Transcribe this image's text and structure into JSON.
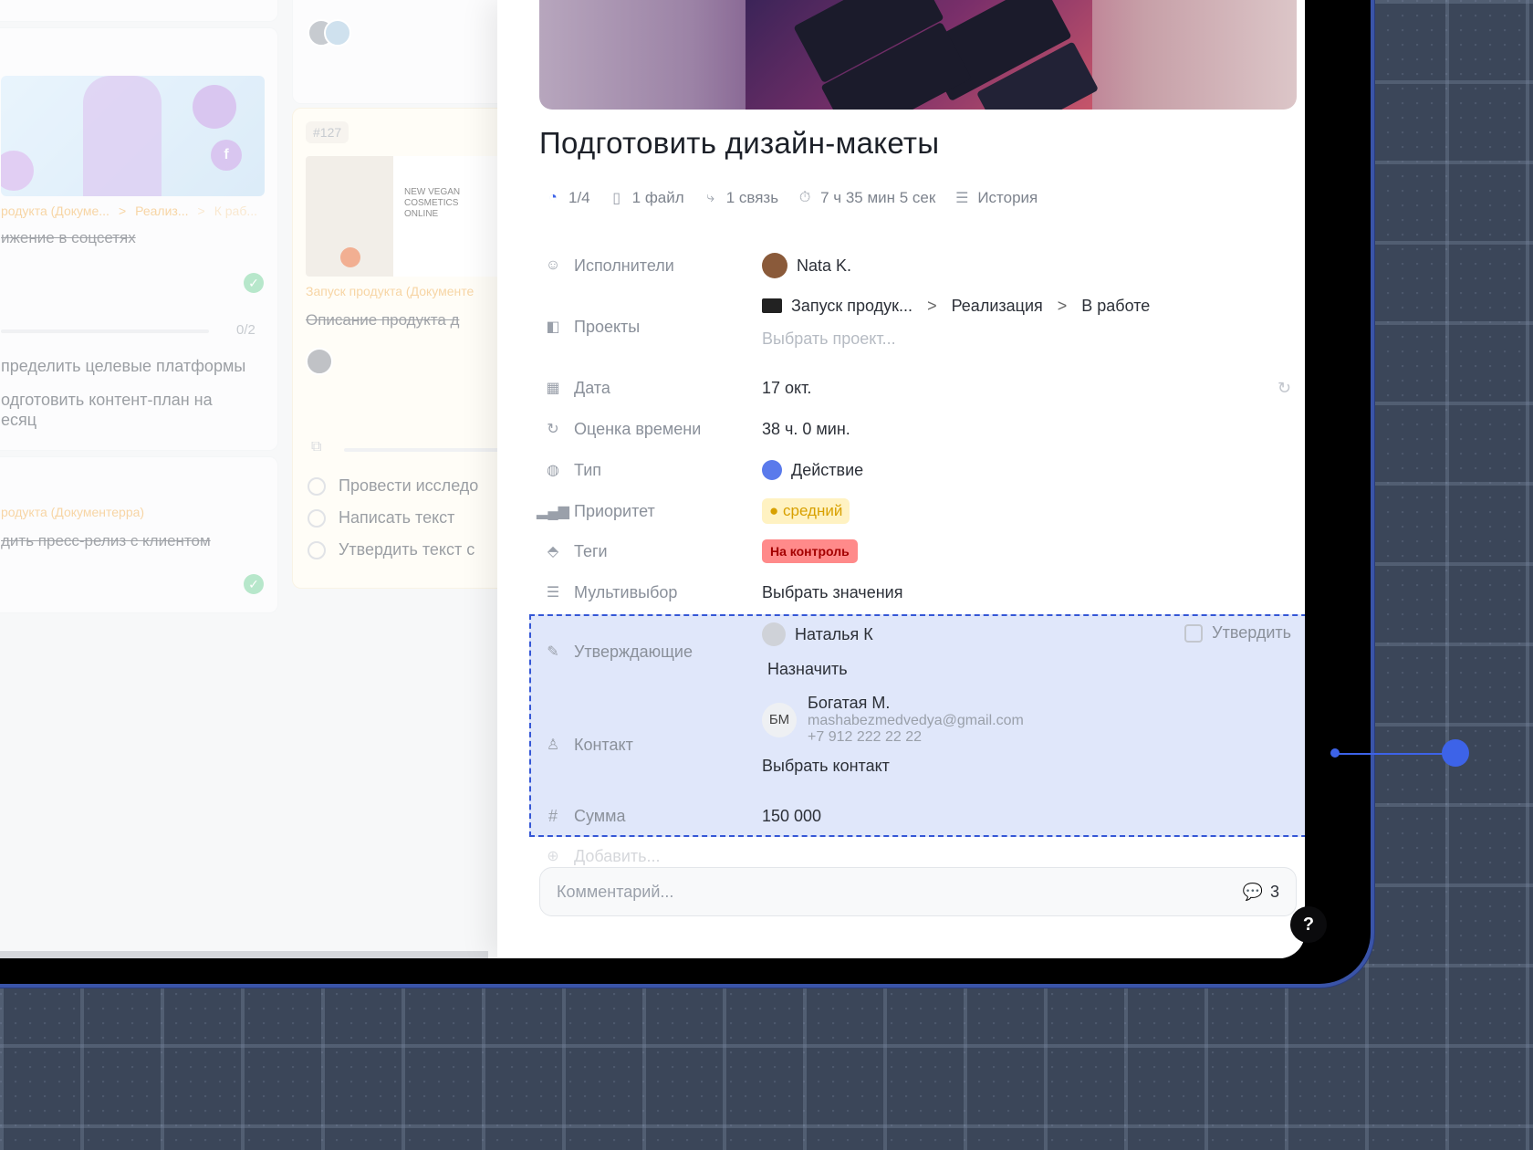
{
  "board": {
    "card1_bullet_text": "ижение в соцсетях",
    "card1_breadcrumb": "родукта (Докуме...",
    "card1_breadcrumb2": "Реализ...",
    "card1_breadcrumb3": "К раб...",
    "card1_progress": "0/2",
    "card1_items": [
      "пределить целевые платформы",
      "одготовить контент-план на",
      "есяц"
    ],
    "card2_breadcrumb": "родукта (Документерра)",
    "card2_strike": "дить пресс-релиз с клиентом",
    "card3_id": "#127",
    "card3_breadcrumb": "Запуск продукта (Документе",
    "card3_strike": "Описание продукта д",
    "card3_mock_title": "NEW VEGAN COSMETICS ONLINE",
    "card3_tasks": [
      "Провести исследо",
      "Написать текст",
      "Утвердить текст с"
    ]
  },
  "task": {
    "title": "Подготовить дизайн-макеты",
    "meta": {
      "subtasks": "1/4",
      "files": "1 файл",
      "links": "1 связь",
      "timer": "7 ч 35 мин 5 сек",
      "history": "История"
    },
    "fields": {
      "assignees_label": "Исполнители",
      "assignee_name": "Nata K.",
      "projects_label": "Проекты",
      "project_path": [
        "Запуск продук...",
        "Реализация",
        "В работе"
      ],
      "project_placeholder": "Выбрать проект...",
      "date_label": "Дата",
      "date_value": "17 окт.",
      "estimate_label": "Оценка времени",
      "estimate_value": "38 ч. 0 мин.",
      "type_label": "Тип",
      "type_value": "Действие",
      "priority_label": "Приоритет",
      "priority_value": "средний",
      "tags_label": "Теги",
      "tag_value": "На контроль",
      "multiselect_label": "Мультивыбор",
      "multiselect_value": "Выбрать значения",
      "approvers_label": "Утверждающие",
      "approver_name": "Наталья К",
      "approve_action": "Утвердить",
      "assign_action": "Назначить",
      "contact_label": "Контакт",
      "contact_initials": "БМ",
      "contact_name": "Богатая М.",
      "contact_email": "mashabezmedvedya@gmail.com",
      "contact_phone": "+7 912 222 22 22",
      "contact_choose": "Выбрать контакт",
      "sum_label": "Сумма",
      "sum_value": "150 000",
      "add_field": "Добавить..."
    },
    "comment_placeholder": "Комментарий...",
    "comment_count": "3",
    "help": "?"
  },
  "colors": {
    "background": "#283244",
    "selection_border": "#3557d6",
    "selection_fill": "#7092e8",
    "priority_bg": "#fff2c2",
    "priority_text": "#d8a000",
    "tag_bg": "#ff8a8a",
    "tag_text": "#a40000",
    "done_green": "#7dd3a0"
  }
}
